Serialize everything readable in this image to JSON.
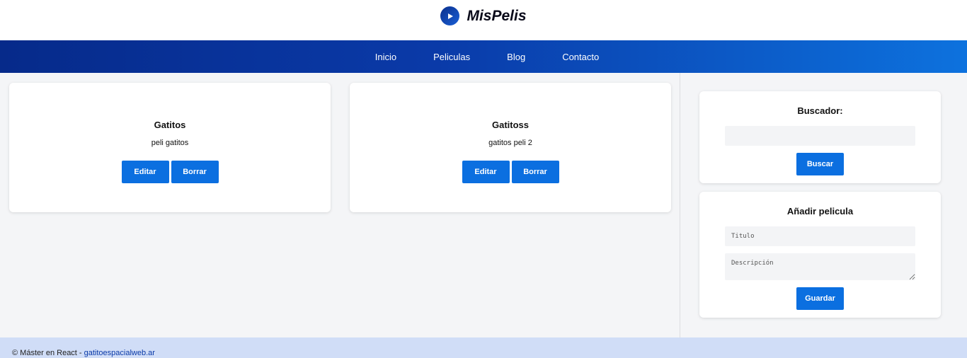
{
  "header": {
    "brand": "MisPelis"
  },
  "nav": {
    "items": [
      "Inicio",
      "Peliculas",
      "Blog",
      "Contacto"
    ]
  },
  "movies": [
    {
      "title": "Gatitos",
      "description": "peli gatitos",
      "edit_label": "Editar",
      "delete_label": "Borrar"
    },
    {
      "title": "Gatitoss",
      "description": "gatitos peli 2",
      "edit_label": "Editar",
      "delete_label": "Borrar"
    }
  ],
  "search": {
    "heading": "Buscador:",
    "placeholder": "",
    "button_label": "Buscar"
  },
  "add_movie": {
    "heading": "Añadir pelicula",
    "title_placeholder": "Titulo",
    "description_placeholder": "Descripción",
    "button_label": "Guardar"
  },
  "footer": {
    "copyright": "© Máster en React - ",
    "link_text": "gatitoespacialweb.ar"
  },
  "colors": {
    "accent": "#0b6fe0",
    "nav_start": "#062a8a",
    "nav_end": "#0d72de",
    "footer_bg": "#d0ddf7"
  }
}
